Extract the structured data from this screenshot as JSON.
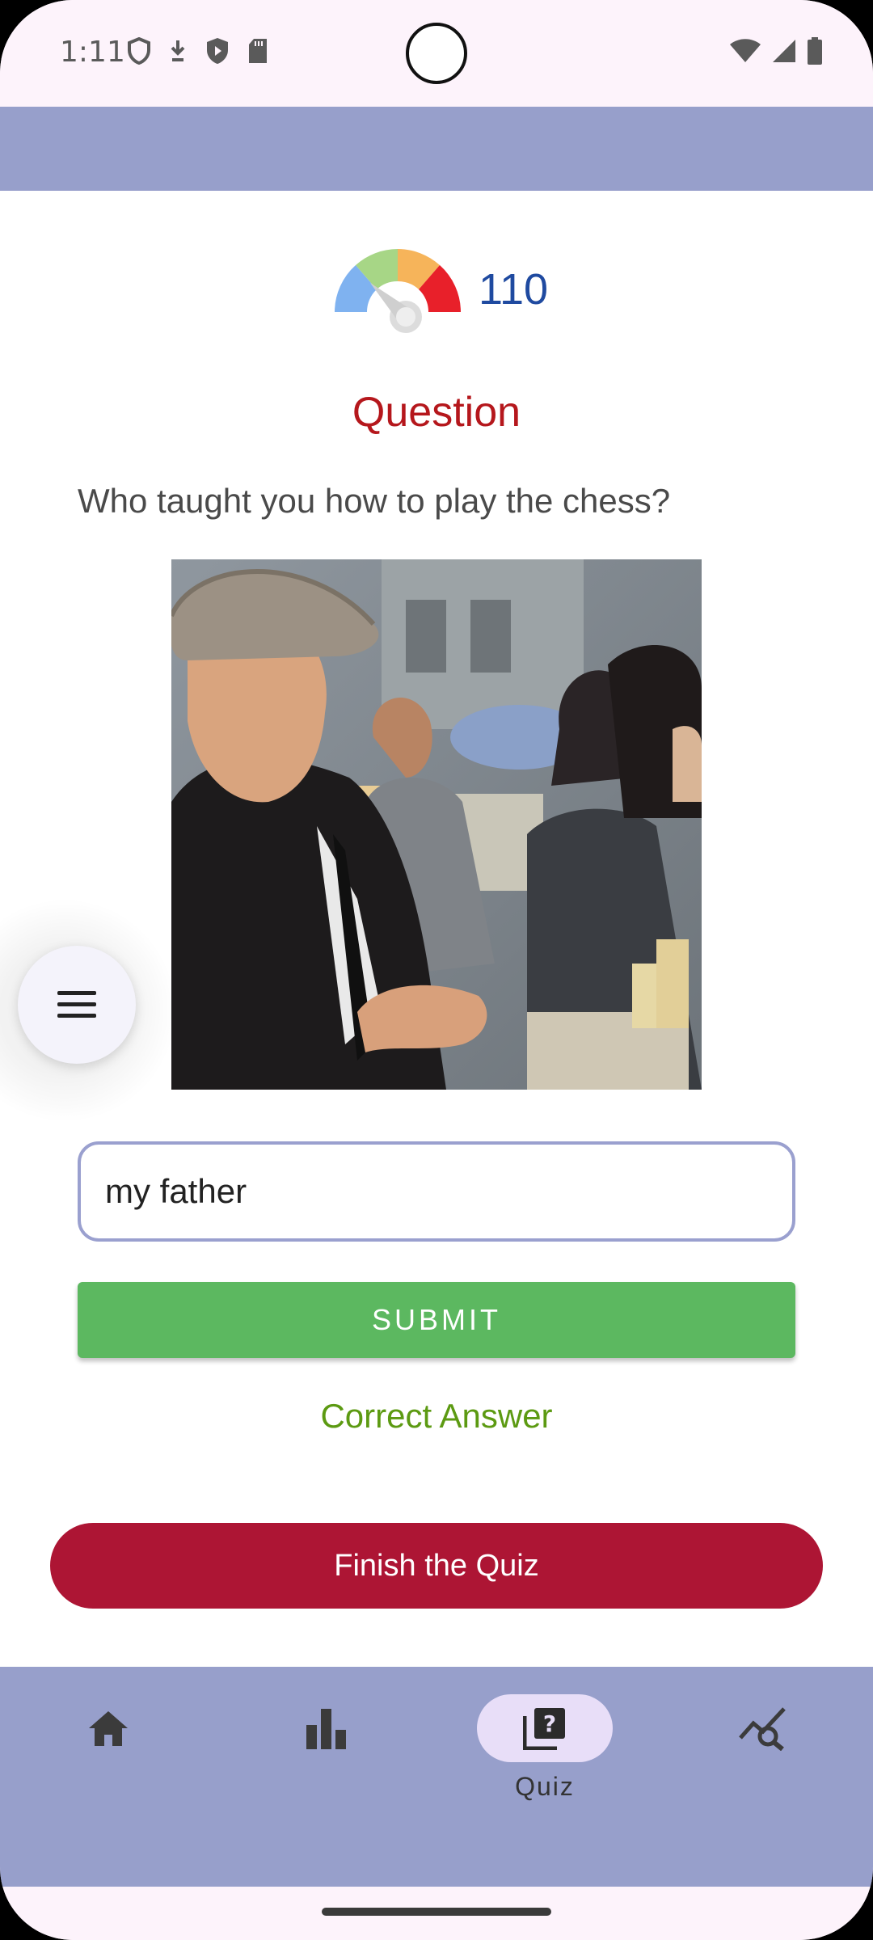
{
  "status_bar": {
    "time": "1:11",
    "left_icons": [
      "shield-outline-icon",
      "download-arrow-icon",
      "shield-play-icon",
      "sd-card-icon"
    ],
    "right_icons": [
      "wifi-icon",
      "signal-icon",
      "battery-icon"
    ]
  },
  "score": {
    "icon": "gauge-icon",
    "value": "110"
  },
  "question": {
    "title": "Question",
    "text": "Who taught you how to play the chess?"
  },
  "answer": {
    "value": "my father",
    "placeholder": ""
  },
  "buttons": {
    "submit_label": "SUBMIT",
    "finish_label": "Finish the Quiz"
  },
  "result": {
    "text": "Correct Answer",
    "color": "#5c9a12"
  },
  "fab": {
    "icon": "menu-icon"
  },
  "bottom_nav": {
    "items": [
      {
        "icon": "home-icon",
        "label": ""
      },
      {
        "icon": "bar-chart-icon",
        "label": ""
      },
      {
        "icon": "quiz-icon",
        "label": "Quiz",
        "active": true
      },
      {
        "icon": "analytics-search-icon",
        "label": ""
      }
    ]
  },
  "colors": {
    "app_bar": "#979fcb",
    "question_title": "#b5171c",
    "submit": "#5cb860",
    "finish": "#ad1534",
    "score": "#1f4aa0"
  }
}
